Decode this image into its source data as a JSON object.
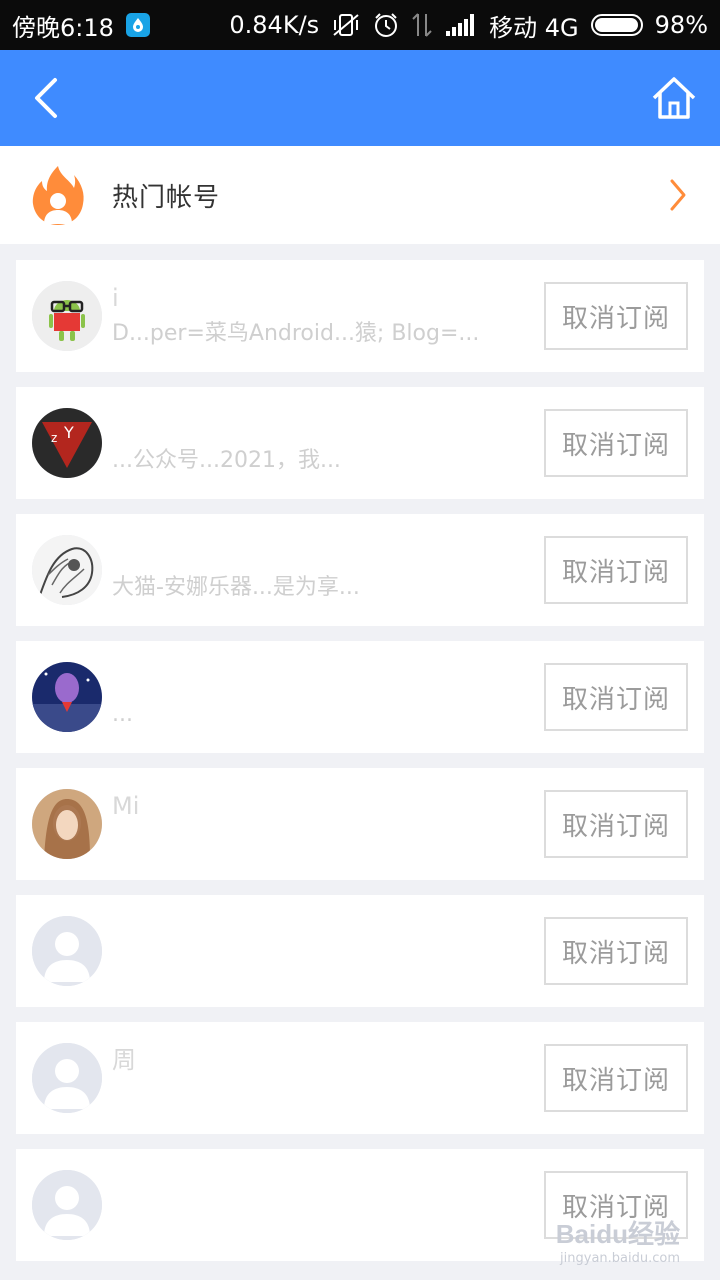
{
  "status_bar": {
    "time": "傍晚6:18",
    "net_speed": "0.84K/s",
    "carrier": "移动 4G",
    "battery": "98%",
    "battery_level": 0.98
  },
  "header": {
    "section_title": "热门帐号"
  },
  "subscriptions": [
    {
      "name": "i",
      "desc": "D...per=菜鸟Android...猿; Blog=...",
      "button": "取消订阅",
      "avatar": "android-glasses"
    },
    {
      "name": "",
      "desc": "...公众号...2021，我...",
      "button": "取消订阅",
      "avatar": "superman"
    },
    {
      "name": "",
      "desc": "大猫-安娜乐器...是为享...",
      "button": "取消订阅",
      "avatar": "sketch"
    },
    {
      "name": "",
      "desc": "...",
      "button": "取消订阅",
      "avatar": "space"
    },
    {
      "name": "Mi",
      "desc": "",
      "button": "取消订阅",
      "avatar": "portrait"
    },
    {
      "name": "",
      "desc": "",
      "button": "取消订阅",
      "avatar": "default"
    },
    {
      "name": "周",
      "desc": "",
      "button": "取消订阅",
      "avatar": "default"
    },
    {
      "name": "",
      "desc": "",
      "button": "取消订阅",
      "avatar": "default"
    }
  ],
  "watermark": {
    "logo": "Baidu经验",
    "url": "jingyan.baidu.com"
  },
  "colors": {
    "appbar": "#3f8bff",
    "accent_orange": "#ff8c3a"
  }
}
